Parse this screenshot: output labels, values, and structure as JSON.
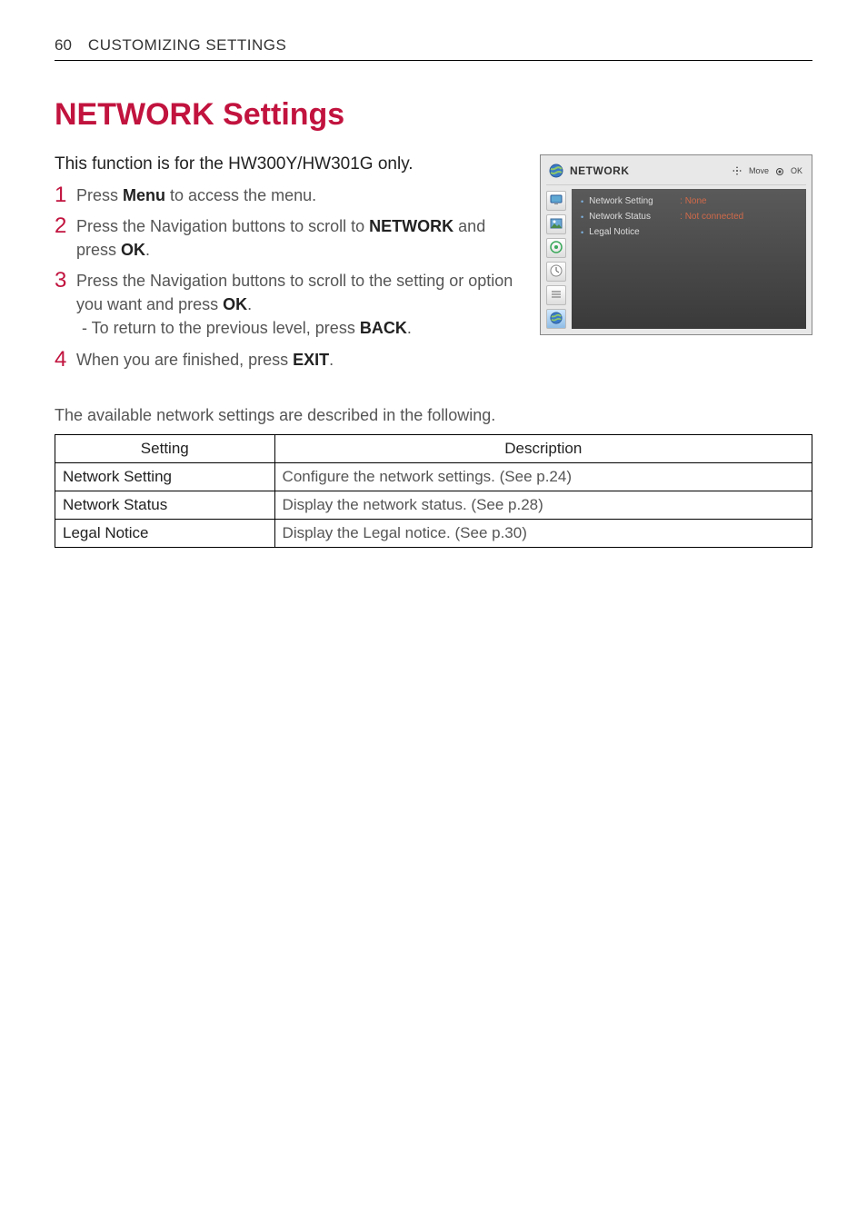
{
  "header": {
    "page_number": "60",
    "section_title": "CUSTOMIZING SETTINGS"
  },
  "main": {
    "title": "NETWORK Settings",
    "subtitle": "This function is for the HW300Y/HW301G only.",
    "steps": [
      {
        "num": "1",
        "pre": "Press ",
        "b1": "Menu",
        "post": " to access the menu."
      },
      {
        "num": "2",
        "pre": "Press the Navigation buttons to scroll to ",
        "b1": "NETWORK",
        "mid": " and press ",
        "b2": "OK",
        "post": "."
      },
      {
        "num": "3",
        "pre": "Press the Navigation buttons to scroll to the setting or option you want and press ",
        "b1": "OK",
        "post": ".",
        "sub_pre": "- To return to the previous level, press ",
        "sub_b": "BACK",
        "sub_post": "."
      },
      {
        "num": "4",
        "pre": "When you are finished, press ",
        "b1": "EXIT",
        "post": "."
      }
    ]
  },
  "osd": {
    "title": "NETWORK",
    "hint_move": "Move",
    "hint_ok": "OK",
    "rows": [
      {
        "label": "Network Setting",
        "value": ": None"
      },
      {
        "label": "Network Status",
        "value": ": Not connected"
      },
      {
        "label": "Legal Notice",
        "value": ""
      }
    ],
    "icons": {
      "header": "globe-icon",
      "tabs": [
        "monitor-icon",
        "photo-icon",
        "audio-icon",
        "clock-icon",
        "options-icon",
        "globe-icon"
      ]
    }
  },
  "table_intro": "The available network settings are described in the following.",
  "table": {
    "head_setting": "Setting",
    "head_desc": "Description",
    "rows": [
      {
        "setting": "Network Setting",
        "desc": "Configure the network settings. (See p.24)"
      },
      {
        "setting": "Network Status",
        "desc": "Display the network status. (See p.28)"
      },
      {
        "setting": "Legal Notice",
        "desc": "Display the Legal notice. (See p.30)"
      }
    ]
  }
}
